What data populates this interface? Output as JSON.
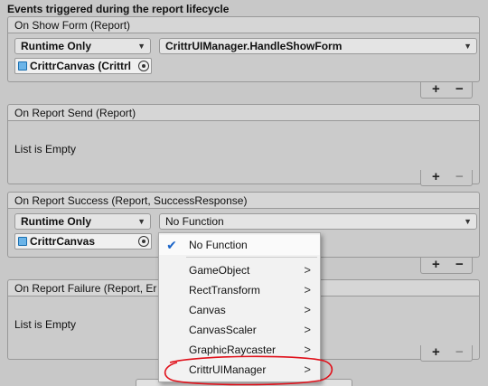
{
  "section": {
    "title": "Events triggered during the report lifecycle"
  },
  "events": [
    {
      "header": "On Show Form (Report)",
      "runtime_dropdown": "Runtime Only",
      "function_dropdown": "CrittrUIManager.HandleShowForm",
      "object_field": "CrittrCanvas (Crittrl"
    },
    {
      "header": "On Report Send (Report)",
      "empty_text": "List is Empty"
    },
    {
      "header": "On Report Success (Report, SuccessResponse)",
      "runtime_dropdown": "Runtime Only",
      "function_dropdown": "No Function",
      "object_field": "CrittrCanvas"
    },
    {
      "header": "On Report Failure (Report, Er",
      "empty_text": "List is Empty"
    }
  ],
  "plus_minus": {
    "plus": "+",
    "minus": "−"
  },
  "popup": {
    "selected_item": "No Function",
    "items": [
      "GameObject",
      "RectTransform",
      "Canvas",
      "CanvasScaler",
      "GraphicRaycaster",
      "CrittrUIManager"
    ],
    "check_glyph": "✔",
    "submenu_arrow": ">"
  },
  "dropdown_arrow": "▼",
  "colors": {
    "check": "#1a64c8",
    "annotation": "#e0101a",
    "object_icon": "#6bb4e8"
  }
}
